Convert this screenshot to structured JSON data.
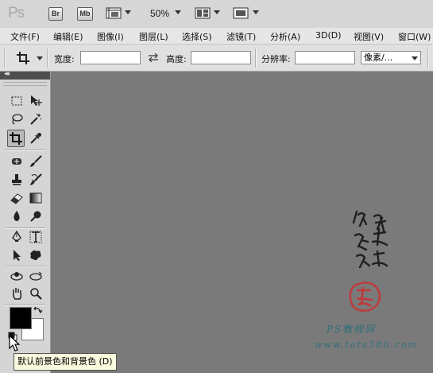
{
  "appbar": {
    "logo": "Ps",
    "bridge": "Br",
    "minibridge": "Mb",
    "zoom": "50%"
  },
  "menu": [
    {
      "label": "文件(F)"
    },
    {
      "label": "编辑(E)"
    },
    {
      "label": "图像(I)"
    },
    {
      "label": "图层(L)"
    },
    {
      "label": "选择(S)"
    },
    {
      "label": "滤镜(T)"
    },
    {
      "label": "分析(A)"
    },
    {
      "label": "3D(D)"
    },
    {
      "label": "视图(V)"
    },
    {
      "label": "窗口(W)"
    }
  ],
  "options": {
    "width_label": "宽度:",
    "width_value": "",
    "height_label": "高度:",
    "height_value": "",
    "resolution_label": "分辨率:",
    "resolution_value": "",
    "unit_value": "像素/..."
  },
  "toolbar": {
    "collapse": "◂◂",
    "tools": [
      "rectangular-marquee-icon",
      "move-icon",
      "lasso-icon",
      "magic-wand-icon",
      "crop-icon",
      "eyedropper-icon",
      "spot-healing-icon",
      "brush-icon",
      "clone-stamp-icon",
      "history-brush-icon",
      "eraser-icon",
      "gradient-icon",
      "blur-icon",
      "dodge-icon",
      "pen-icon",
      "type-icon",
      "path-selection-icon",
      "custom-shape-icon",
      "3d-rotate-icon",
      "3d-orbit-icon",
      "hand-icon",
      "zoom-icon"
    ],
    "active_tool": "crop-icon",
    "foreground_color": "#000000",
    "background_color": "#ffffff"
  },
  "tooltip": "默认前景色和背景色 (D)",
  "watermark": {
    "title": "PS教程网",
    "url": "www.tata580.com",
    "color": "#2f6f7a",
    "seal_color": "#c0393b"
  }
}
